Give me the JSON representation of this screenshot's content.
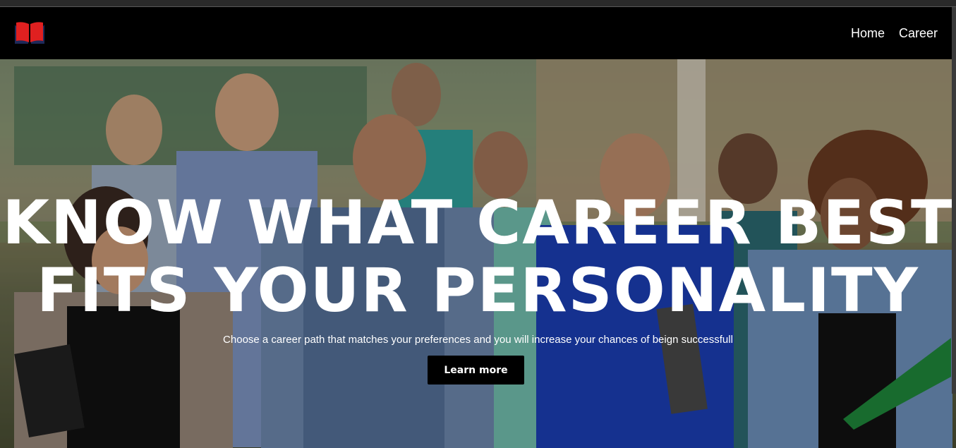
{
  "nav": {
    "logo_icon": "open-book-icon",
    "links": [
      {
        "label": "Home"
      },
      {
        "label": "Career"
      }
    ]
  },
  "hero": {
    "headline_line1": "KNOW WHAT CAREER BEST",
    "headline_line2": "FITS YOUR PERSONALITY",
    "subtitle": "Choose a career path that matches your preferences and you will increase your chances of beign successfull",
    "button_label": "Learn more"
  },
  "colors": {
    "navbar_bg": "#000000",
    "logo_red": "#e02020",
    "logo_navy": "#1e2a5a",
    "button_bg": "#000000",
    "text": "#ffffff"
  }
}
